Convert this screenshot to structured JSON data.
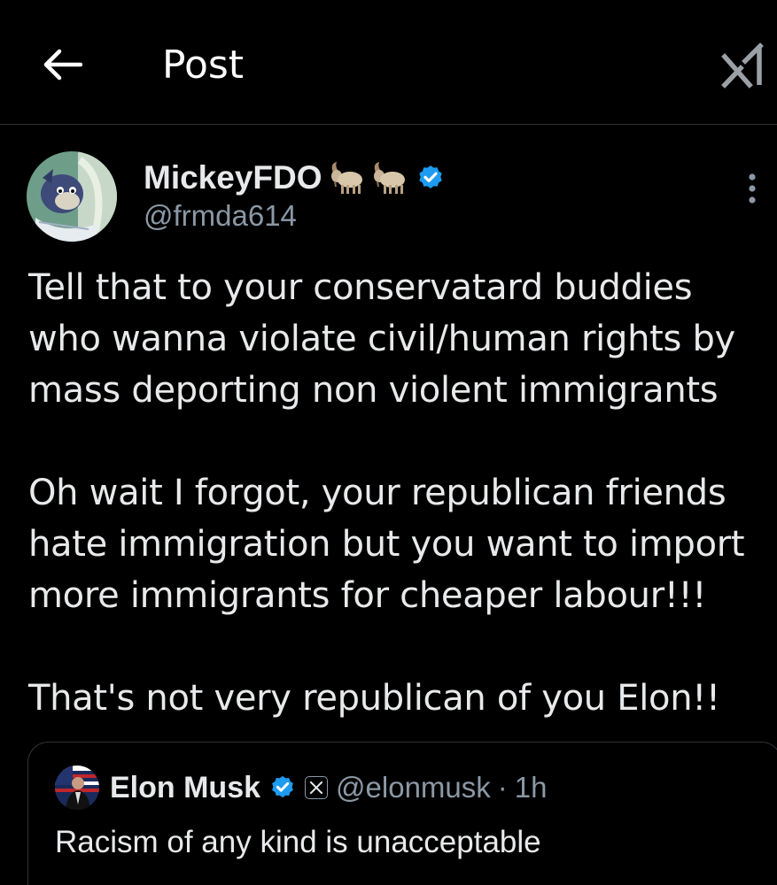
{
  "header": {
    "title": "Post",
    "back_icon": "arrow-left-icon",
    "grok_icon": "grok-icon"
  },
  "post": {
    "author": {
      "display_name": "MickeyFDO",
      "name_emojis": [
        "goat",
        "goat"
      ],
      "handle": "@frmda614",
      "verified": true
    },
    "text_paragraphs": [
      "Tell that to your conservatard buddies\nwho wanna violate civil/human rights by\nmass deporting non violent immigrants",
      "Oh wait I forgot, your republican friends\nhate immigration but you want to import\nmore immigrants for cheaper labour!!!",
      "That's not very republican of you Elon!!"
    ],
    "more_icon": "more-vertical-icon"
  },
  "quote": {
    "author": {
      "display_name": "Elon Musk",
      "verified": true,
      "affiliation": "X",
      "handle": "@elonmusk"
    },
    "separator": "·",
    "time": "1h",
    "text": "Racism of any kind is unacceptable"
  },
  "colors": {
    "background": "#000000",
    "text": "#e7e9ea",
    "secondary_text": "#8b98a5",
    "verified_blue": "#1d9bf0",
    "divider": "#2f3336"
  }
}
